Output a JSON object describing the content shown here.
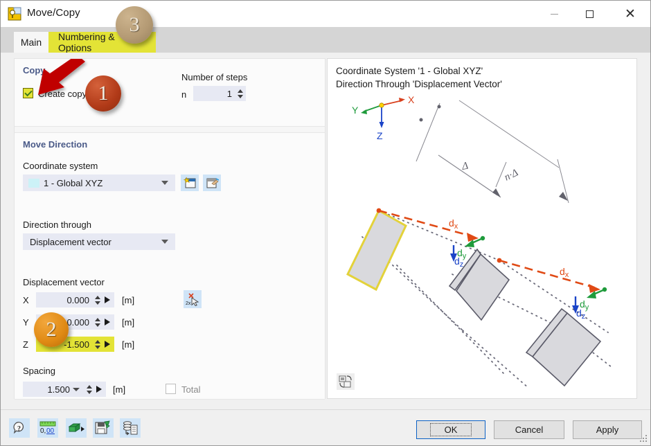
{
  "window": {
    "title": "Move/Copy",
    "icon": "move-copy-icon",
    "controls": {
      "minimize": "—",
      "maximize": "□",
      "close": "✕"
    }
  },
  "tabs": [
    {
      "id": "main",
      "label": "Main",
      "selected": true
    },
    {
      "id": "numbering",
      "label": "Numbering & Options",
      "selected": false,
      "highlighted": true
    }
  ],
  "copy_group": {
    "title": "Copy",
    "create_copy": {
      "label": "Create copy",
      "checked": true
    },
    "number_of_steps": {
      "label": "Number of steps",
      "variable": "n",
      "value": "1"
    }
  },
  "move_direction_group": {
    "title": "Move Direction",
    "coordinate_system": {
      "label": "Coordinate system",
      "value": "1 - Global XYZ",
      "new_button": "new-coordinate-system-icon",
      "edit_button": "edit-coordinate-system-icon"
    },
    "direction_through": {
      "label": "Direction through",
      "value": "Displacement vector"
    },
    "displacement_vector": {
      "label": "Displacement vector",
      "unit": "[m]",
      "pick_button": "pick-two-points-icon",
      "rows": [
        {
          "axis": "X",
          "value": "0.000",
          "unit": "[m]",
          "highlighted": false
        },
        {
          "axis": "Y",
          "value": "0.000",
          "unit": "[m]",
          "highlighted": false
        },
        {
          "axis": "Z",
          "value": "-1.500",
          "unit": "[m]",
          "highlighted": true
        }
      ]
    },
    "spacing": {
      "label": "Spacing",
      "value": "1.500",
      "unit": "[m]",
      "total": {
        "label": "Total",
        "checked": false,
        "enabled": false
      }
    }
  },
  "preview": {
    "title_line1": "Coordinate System '1 - Global XYZ'",
    "title_line2": "Direction Through 'Displacement Vector'",
    "axes": [
      {
        "name": "X",
        "color": "#d9411e"
      },
      {
        "name": "Y",
        "color": "#1f9b3c"
      },
      {
        "name": "Z",
        "color": "#1b44c8"
      }
    ],
    "dimension_labels": [
      {
        "text": "Δ",
        "name": "delta-label"
      },
      {
        "text": "n·Δ",
        "name": "n-delta-label"
      }
    ],
    "vector_labels": [
      {
        "text": "d",
        "sub": "x",
        "color": "#d9411e",
        "name": "dx-label-1"
      },
      {
        "text": "d",
        "sub": "y",
        "color": "#1f9b3c",
        "name": "dy-label-1"
      },
      {
        "text": "d",
        "sub": "z",
        "color": "#1b44c8",
        "name": "dz-label-1"
      },
      {
        "text": "d",
        "sub": "x",
        "color": "#d9411e",
        "name": "dx-label-2"
      },
      {
        "text": "d",
        "sub": "y",
        "color": "#1f9b3c",
        "name": "dy-label-2"
      },
      {
        "text": "d",
        "sub": "z",
        "color": "#1b44c8",
        "name": "dz-label-2"
      }
    ],
    "corner_button": "preview-settings-icon"
  },
  "toolbar": [
    {
      "name": "help-icon",
      "label": ""
    },
    {
      "name": "units-decimal-places-icon",
      "label": "0,00"
    },
    {
      "name": "import-parameters-icon",
      "label": ""
    },
    {
      "name": "save-defaults-icon",
      "label": ""
    },
    {
      "name": "database-report-icon",
      "label": ""
    }
  ],
  "buttons": {
    "ok": "OK",
    "cancel": "Cancel",
    "apply": "Apply"
  },
  "annotations": [
    {
      "id": "1",
      "text": "1",
      "color": "#b13a18"
    },
    {
      "id": "2",
      "text": "2",
      "color": "#e08a14"
    },
    {
      "id": "3",
      "text": "3",
      "color": "#b49a74"
    }
  ]
}
